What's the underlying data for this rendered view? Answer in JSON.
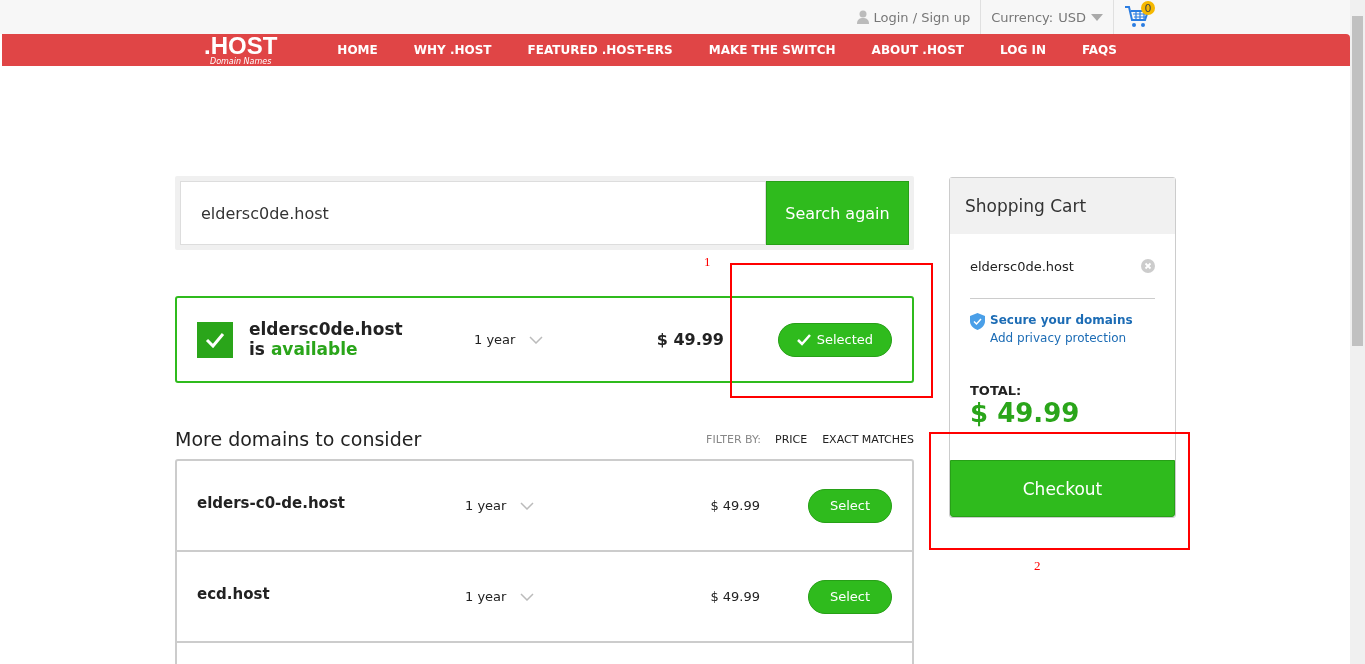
{
  "top_bar": {
    "login": "Login / Sign up",
    "currency_label": "Currency:",
    "currency": "USD",
    "cart_count": "0"
  },
  "nav": {
    "logo": ".HOST",
    "logo_sub": "Domain Names",
    "items": [
      "HOME",
      "WHY .HOST",
      "FEATURED .HOST-ERS",
      "MAKE THE SWITCH",
      "ABOUT .HOST",
      "LOG IN",
      "FAQS"
    ]
  },
  "search": {
    "value": "eldersc0de.host",
    "button": "Search again"
  },
  "result": {
    "domain": "eldersc0de.host",
    "status_prefix": "is",
    "status": "available",
    "term": "1 year",
    "price": "$ 49.99",
    "button": "Selected",
    "selected": true
  },
  "more": {
    "title": "More domains to consider",
    "filter_label": "FILTER BY:",
    "filters": [
      "PRICE",
      "EXACT MATCHES"
    ],
    "rows": [
      {
        "domain": "elders-c0-de.host",
        "term": "1 year",
        "price": "$ 49.99",
        "button": "Select",
        "selected": false
      },
      {
        "domain": "ecd.host",
        "term": "1 year",
        "price": "$ 49.99",
        "button": "Select",
        "selected": false
      }
    ]
  },
  "cart": {
    "title": "Shopping Cart",
    "item": "eldersc0de.host",
    "secure": "Secure your domains",
    "privacy": "Add privacy protection",
    "total_label": "TOTAL:",
    "total": "$ 49.99",
    "checkout": "Checkout"
  },
  "annotations": [
    "1",
    "2"
  ]
}
